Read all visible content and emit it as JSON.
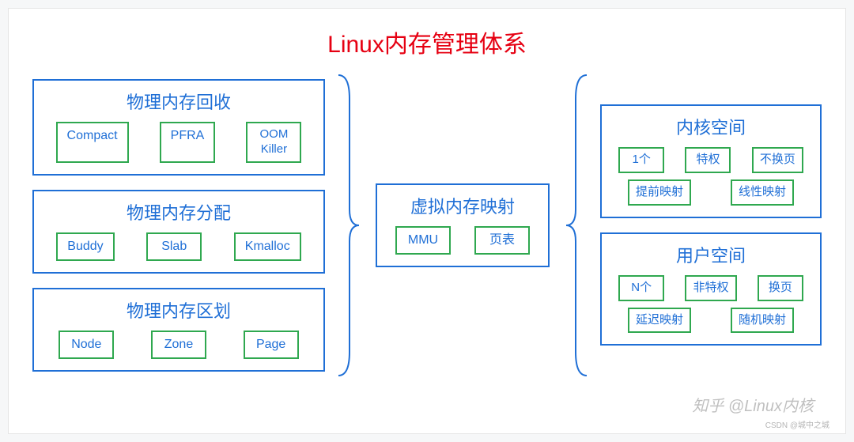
{
  "title": "Linux内存管理体系",
  "left": {
    "reclaim": {
      "title": "物理内存回收",
      "items": [
        "Compact",
        "PFRA",
        "OOM\nKiller"
      ]
    },
    "alloc": {
      "title": "物理内存分配",
      "items": [
        "Buddy",
        "Slab",
        "Kmalloc"
      ]
    },
    "zone": {
      "title": "物理内存区划",
      "items": [
        "Node",
        "Zone",
        "Page"
      ]
    }
  },
  "mid": {
    "map": {
      "title": "虚拟内存映射",
      "items": [
        "MMU",
        "页表"
      ]
    }
  },
  "right": {
    "kernel": {
      "title": "内核空间",
      "items": [
        "1个",
        "特权",
        "不换页",
        "提前映射",
        "线性映射"
      ]
    },
    "user": {
      "title": "用户空间",
      "items": [
        "N个",
        "非特权",
        "换页",
        "延迟映射",
        "随机映射"
      ]
    }
  },
  "watermark": "知乎 @Linux内核",
  "csdn": "CSDN @城中之城"
}
